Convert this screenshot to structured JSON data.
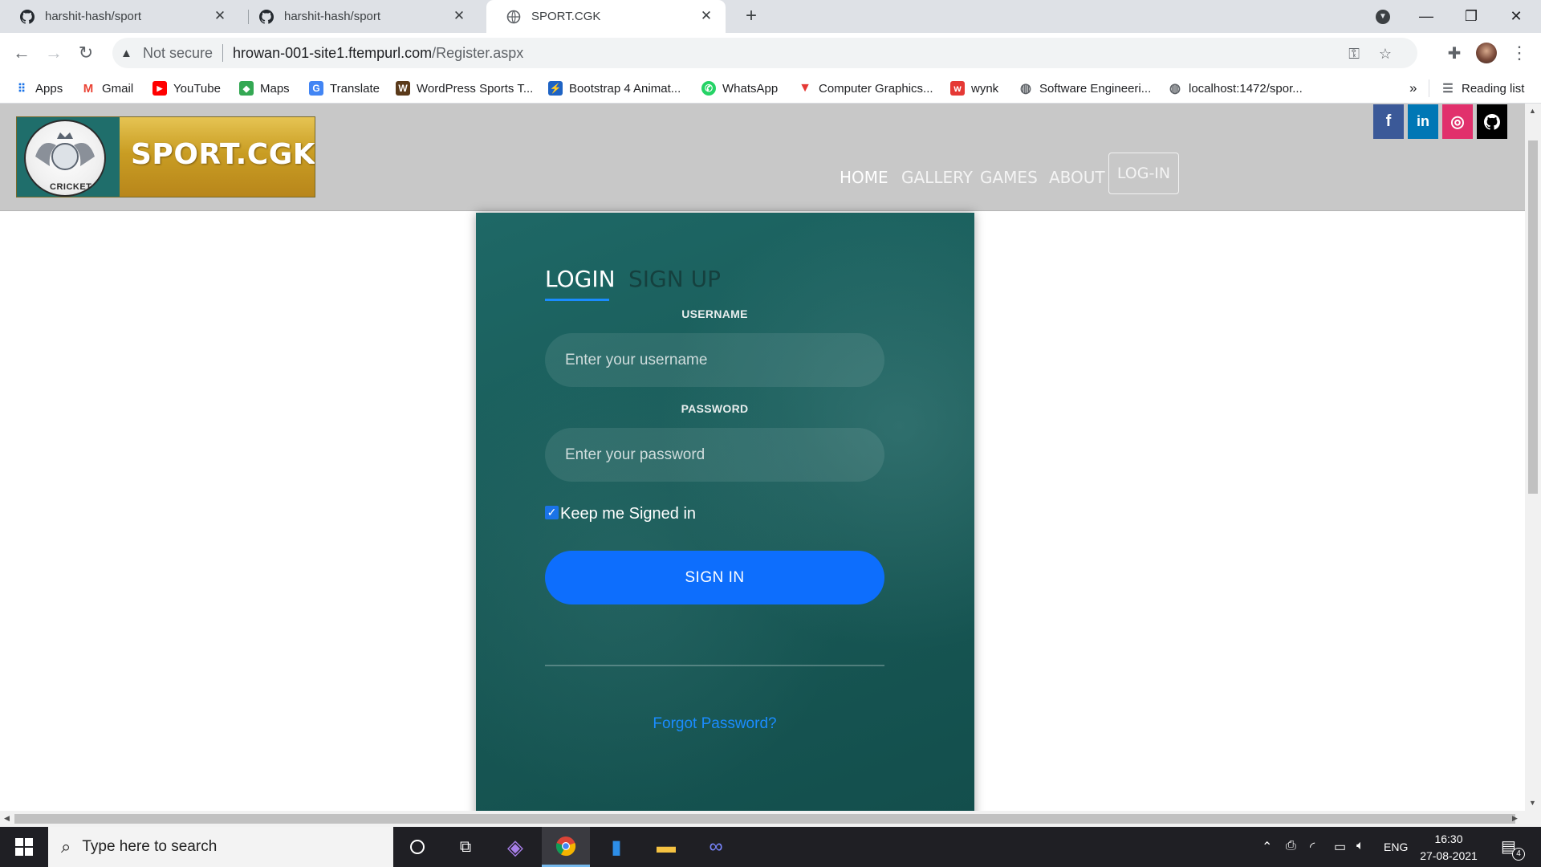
{
  "browser": {
    "tabs": [
      {
        "title": "harshit-hash/sport",
        "active": false
      },
      {
        "title": "harshit-hash/sport",
        "active": false
      },
      {
        "title": "SPORT.CGK",
        "active": true
      }
    ],
    "new_tab_symbol": "+",
    "address": {
      "security_label": "Not secure",
      "domain": "hrowan-001-site1.ftempurl.com",
      "path": "/Register.aspx"
    },
    "bookmarks": [
      {
        "label": "Apps",
        "icon": "apps-grid-icon"
      },
      {
        "label": "Gmail",
        "icon": "gmail-icon",
        "color": "#ea4335"
      },
      {
        "label": "YouTube",
        "icon": "youtube-icon",
        "color": "#ff0000"
      },
      {
        "label": "Maps",
        "icon": "maps-icon",
        "color": "#34a853"
      },
      {
        "label": "Translate",
        "icon": "translate-icon",
        "color": "#4285f4"
      },
      {
        "label": "WordPress Sports T...",
        "icon": "wordpress-icon",
        "color": "#5a3a1a"
      },
      {
        "label": "Bootstrap 4 Animat...",
        "icon": "bootstrap-icon",
        "color": "#1e63c4"
      },
      {
        "label": "WhatsApp",
        "icon": "whatsapp-icon",
        "color": "#25d366"
      },
      {
        "label": "Computer Graphics...",
        "icon": "graphics-icon",
        "color": "#e53935"
      },
      {
        "label": "wynk",
        "icon": "wynk-icon",
        "color": "#e53935"
      },
      {
        "label": "Software Engineeri...",
        "icon": "globe-icon",
        "color": "#5f6368"
      },
      {
        "label": "localhost:1472/spor...",
        "icon": "globe-icon",
        "color": "#5f6368"
      }
    ],
    "overflow_label": "»",
    "reading_list_label": "Reading list"
  },
  "site": {
    "logo": {
      "brand": "SPORT.CGK",
      "emblem_text": "CRICKET"
    },
    "nav": [
      {
        "label": "HOME",
        "active": true
      },
      {
        "label": "GALLERY",
        "active": false
      },
      {
        "label": "GAMES",
        "active": false
      },
      {
        "label": "ABOUT",
        "active": false
      }
    ],
    "login_button": "LOG-IN",
    "social": [
      {
        "label": "f",
        "name": "facebook",
        "color": "#3b5998"
      },
      {
        "label": "in",
        "name": "linkedin",
        "color": "#0077b5"
      },
      {
        "label": "◎",
        "name": "instagram",
        "color": "#e1306c"
      },
      {
        "label": "●",
        "name": "github",
        "color": "#000000"
      }
    ]
  },
  "form": {
    "tabs": {
      "login": "LOGIN",
      "signup": "SIGN UP"
    },
    "username": {
      "label": "USERNAME",
      "placeholder": "Enter your username",
      "value": ""
    },
    "password": {
      "label": "PASSWORD",
      "placeholder": "Enter your password",
      "value": ""
    },
    "remember": {
      "label": "Keep me Signed in",
      "checked": true
    },
    "submit": "SIGN IN",
    "forgot": "Forgot Password?",
    "accent": "#0d6efd"
  },
  "taskbar": {
    "search_placeholder": "Type here to search",
    "language": "ENG",
    "time": "16:30",
    "date": "27-08-2021",
    "notification_count": "4"
  }
}
